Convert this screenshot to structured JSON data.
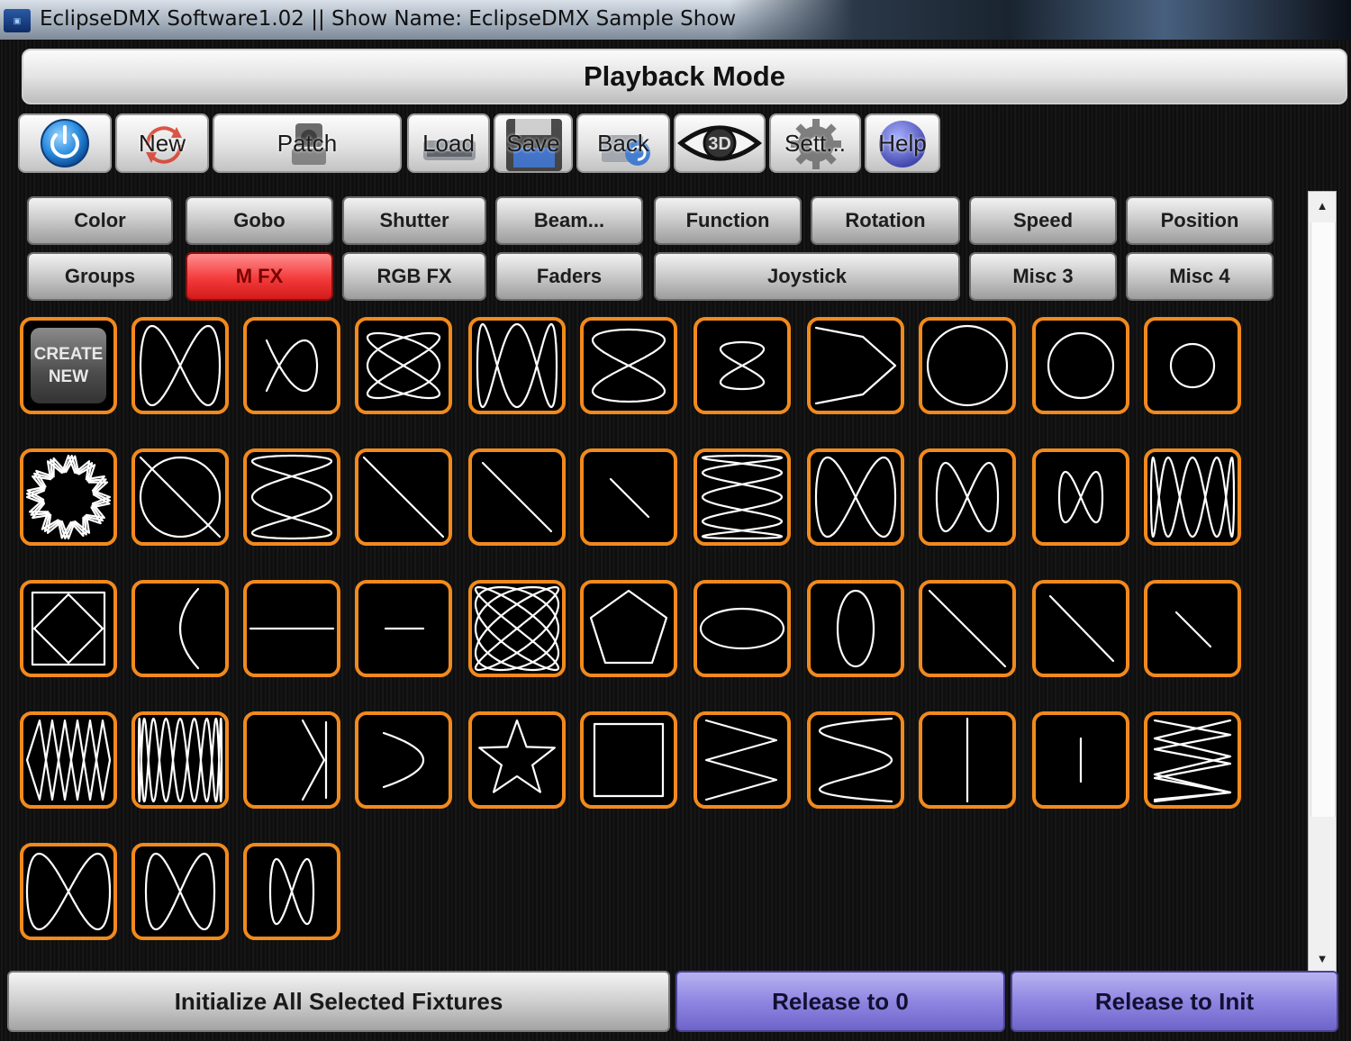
{
  "window": {
    "title": "EclipseDMX Software1.02 || Show Name: EclipseDMX Sample Show"
  },
  "header": {
    "mode_title": "Playback Mode"
  },
  "toolbar": {
    "new_label": "New",
    "patch_label": "Patch",
    "load_label": "Load",
    "save_label": "Save",
    "back_label": "Back",
    "view_3d_label": "3D",
    "settings_label": "Sett...",
    "help_label": "Help"
  },
  "tabs": {
    "row1": [
      "Color",
      "Gobo",
      "Shutter",
      "Beam...",
      "Function",
      "Rotation",
      "Speed",
      "Position"
    ],
    "row2": [
      "Groups",
      "M FX",
      "RGB FX",
      "Faders",
      "Joystick",
      "Misc 3",
      "Misc 4"
    ],
    "active": "M FX",
    "active_color": "#f33b3b"
  },
  "fx_grid": {
    "create_line1": "CREATE",
    "create_line2": "NEW",
    "tile_border_color": "#f18a1d",
    "pattern_count": 46,
    "patterns": [
      "lissajous-1-2",
      "lissajous-small",
      "lissajous-mesh",
      "lissajous-tall",
      "lissajous-infinity",
      "lissajous-infinity-small",
      "triangle-arrow",
      "circle-large",
      "circle-medium",
      "circle-small",
      "star-burst",
      "diamond-mesh",
      "vertical-lissajous",
      "diagonal-line-long",
      "diagonal-line-medium",
      "diagonal-line-short",
      "vertical-weave",
      "figure-eight-large",
      "figure-eight-medium",
      "figure-eight-small",
      "horizontal-zigzag",
      "diamond-in-square",
      "arc",
      "horizontal-line-long",
      "horizontal-line-short",
      "dense-mesh",
      "pentagon",
      "ellipse-horizontal",
      "ellipse-vertical",
      "diagonal-line-long-2",
      "diagonal-line-medium-2",
      "diagonal-line-short-2",
      "diamond-chain",
      "dense-horizontal",
      "bracket-arrow",
      "figure-eight-vertical",
      "star",
      "square",
      "zigzag-right",
      "vertical-bow",
      "vertical-line-long",
      "vertical-line-short",
      "fan-mesh",
      "hourglass-large",
      "hourglass-medium",
      "hourglass-small"
    ]
  },
  "footer": {
    "initialize_label": "Initialize All Selected Fixtures",
    "release_zero_label": "Release to 0",
    "release_init_label": "Release to Init",
    "release_color": "#8f86e2"
  }
}
